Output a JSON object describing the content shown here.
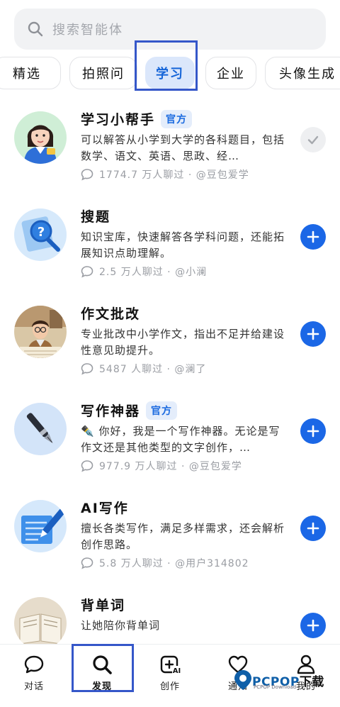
{
  "search": {
    "placeholder": "搜索智能体"
  },
  "tabs": [
    {
      "label": "精选"
    },
    {
      "label": "拍照问"
    },
    {
      "label": "学习"
    },
    {
      "label": "企业"
    },
    {
      "label": "头像生成"
    }
  ],
  "active_tab": "学习",
  "agents": [
    {
      "title": "学习小帮手",
      "badge": "官方",
      "desc": "可以解答从小学到大学的各科题目，包括数学、语文、英语、思政、经…",
      "meta": "1774.7 万人聊过 · @豆包爱学",
      "state": "added",
      "icon": "check-icon"
    },
    {
      "title": "搜题",
      "badge": "",
      "desc": "知识宝库，快速解答各学科问题，还能拓展知识点助理解。",
      "meta": "2.5 万人聊过 · @小澜",
      "state": "add",
      "icon": "plus-icon"
    },
    {
      "title": "作文批改",
      "badge": "",
      "desc": "专业批改中小学作文，指出不足并给建设性意见助提升。",
      "meta": "5487 人聊过 · @澜了",
      "state": "add",
      "icon": "plus-icon"
    },
    {
      "title": "写作神器",
      "badge": "官方",
      "desc": "✒️ 你好，我是一个写作神器。无论是写作文还是其他类型的文字创作，…",
      "meta": "977.9 万人聊过 · @豆包爱学",
      "state": "add",
      "icon": "plus-icon"
    },
    {
      "title": "AI写作",
      "badge": "",
      "desc": "擅长各类写作，满足多样需求，还会解析创作思路。",
      "meta": "5.8 万人聊过 · @用户314802",
      "state": "add",
      "icon": "plus-icon"
    },
    {
      "title": "背单词",
      "badge": "",
      "desc": "让她陪你背单词",
      "meta": "",
      "state": "add",
      "icon": "plus-icon"
    }
  ],
  "nav": [
    {
      "label": "对话",
      "icon": "chat-icon"
    },
    {
      "label": "发现",
      "icon": "search-icon"
    },
    {
      "label": "创作",
      "icon": "create-ai-icon"
    },
    {
      "label": "通知",
      "icon": "heart-icon"
    },
    {
      "label": "我的",
      "icon": "profile-icon"
    }
  ],
  "active_nav": "发现",
  "watermark": {
    "brand_a": "PCPOP",
    "brand_b": "下载",
    "sub": "PCPOP Download"
  },
  "colors": {
    "accent": "#1b67e6",
    "highlight_box": "#3557c9",
    "active_tab_bg": "#dbe7fb"
  }
}
